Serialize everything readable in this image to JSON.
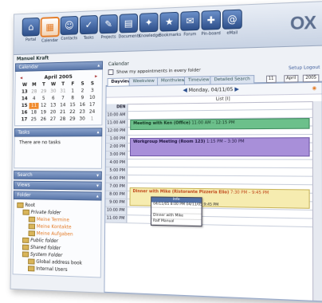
{
  "toolbar": {
    "items": [
      {
        "label": "Portal",
        "icon": "portal-icon",
        "glyph": "⌂"
      },
      {
        "label": "Calendar",
        "icon": "calendar-icon",
        "glyph": "▦",
        "active": true
      },
      {
        "label": "Contacts",
        "icon": "contacts-icon",
        "glyph": "☺"
      },
      {
        "label": "Tasks",
        "icon": "tasks-icon",
        "glyph": "✓"
      },
      {
        "label": "Projects",
        "icon": "projects-icon",
        "glyph": "✎"
      },
      {
        "label": "Documents",
        "icon": "documents-icon",
        "glyph": "▤"
      },
      {
        "label": "Knowledge",
        "icon": "knowledge-icon",
        "glyph": "✦"
      },
      {
        "label": "Bookmarks",
        "icon": "bookmarks-icon",
        "glyph": "★"
      },
      {
        "label": "Forum",
        "icon": "forum-icon",
        "glyph": "✉"
      },
      {
        "label": "Pin-board",
        "icon": "pinboard-icon",
        "glyph": "✚"
      },
      {
        "label": "eMail",
        "icon": "email-icon",
        "glyph": "@"
      }
    ],
    "logo": "OX"
  },
  "user": "Manuel Kraft",
  "sidebar": {
    "calendar_title": "Calendar",
    "month": "April 2005",
    "day_headers": [
      "W",
      "M",
      "T",
      "W",
      "T",
      "F",
      "S",
      "S"
    ],
    "weeks": [
      [
        "13",
        "28",
        "29",
        "30",
        "31",
        "1",
        "2",
        "3"
      ],
      [
        "14",
        "4",
        "5",
        "6",
        "7",
        "8",
        "9",
        "10"
      ],
      [
        "15",
        "11",
        "12",
        "13",
        "14",
        "15",
        "16",
        "17"
      ],
      [
        "16",
        "18",
        "19",
        "20",
        "21",
        "22",
        "23",
        "24"
      ],
      [
        "17",
        "25",
        "26",
        "27",
        "28",
        "29",
        "30",
        "1"
      ]
    ],
    "tasks_title": "Tasks",
    "tasks_empty": "There are no tasks",
    "search_title": "Search",
    "views_title": "Views",
    "folder_title": "Folder",
    "folders": [
      {
        "label": "Root",
        "indent": 0,
        "style": ""
      },
      {
        "label": "Private folder",
        "indent": 1,
        "style": "it"
      },
      {
        "label": "Meine Termine",
        "indent": 2,
        "style": "orange"
      },
      {
        "label": "Meine Kontakte",
        "indent": 2,
        "style": "orange"
      },
      {
        "label": "Meine Aufgaben",
        "indent": 2,
        "style": "orange"
      },
      {
        "label": "Public folder",
        "indent": 1,
        "style": "it"
      },
      {
        "label": "Shared folder",
        "indent": 1,
        "style": "it"
      },
      {
        "label": "System Folder",
        "indent": 1,
        "style": "it"
      },
      {
        "label": "Global address book",
        "indent": 2,
        "style": ""
      },
      {
        "label": "Internal Users",
        "indent": 2,
        "style": ""
      }
    ]
  },
  "main": {
    "title": "Calendar",
    "show_all_label": "Show my appointments in every folder",
    "right_links": "Setup  Logout",
    "selects": [
      "11",
      "April",
      "2005"
    ],
    "tabs": [
      "Dayview",
      "Weekview",
      "Monthview",
      "Timeview",
      "Detailed Search"
    ],
    "day_label": "Monday, 04/11/05",
    "col_label": "List [I]",
    "hours": [
      "DEN",
      "10:00 AM",
      "11:00 AM",
      "12:00 PM",
      "1:00 PM",
      "2:00 PM",
      "3:00 PM",
      "4:00 PM",
      "5:00 PM",
      "6:00 PM",
      "7:00 PM",
      "8:00 PM",
      "9:00 PM",
      "10:00 PM",
      "11:00 PM"
    ],
    "appointments": [
      {
        "title": "Meeting with Ken (Office)",
        "time": "11:00 AM – 12:15 PM",
        "color": "green"
      },
      {
        "title": "Workgroup Meeting (Room 123)",
        "time": "1:15 PM – 3:30 PM",
        "color": "purple"
      },
      {
        "title": "Dinner with Mike (Ristorante Pizzeria Elio)",
        "time": "7:30 PM – 9:45 PM",
        "color": "yellow"
      }
    ],
    "popup": {
      "title": "Info",
      "rows": [
        "04/11/05 8:00 PM  04/11/05 9:45 PM",
        "",
        "Dinner with Mike",
        "Ralf Manual"
      ]
    }
  }
}
